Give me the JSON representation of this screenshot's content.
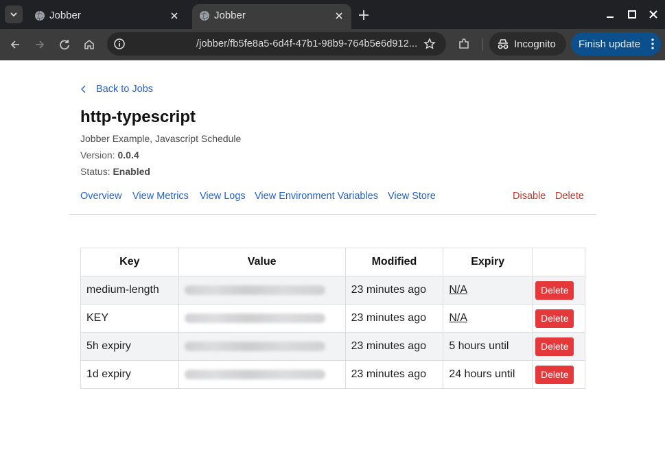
{
  "browser": {
    "tabs": [
      {
        "title": "Jobber",
        "active": false
      },
      {
        "title": "Jobber",
        "active": true
      }
    ],
    "url": "/jobber/fb5fe8a5-6d4f-47b1-98b9-764b5e6d912...",
    "incognito_label": "Incognito",
    "finish_update_label": "Finish update",
    "icons": [
      "tab-search-icon",
      "globe-icon",
      "close-icon",
      "plus-icon",
      "minimize-icon",
      "maximize-icon",
      "window-close-icon",
      "back-arrow-icon",
      "forward-arrow-icon",
      "reload-icon",
      "home-icon",
      "info-icon",
      "star-icon",
      "extensions-icon",
      "incognito-icon",
      "more-vert-icon"
    ]
  },
  "page": {
    "back_label": "Back to Jobs",
    "title": "http-typescript",
    "description": "Jobber Example, Javascript Schedule",
    "version_label": "Version: ",
    "version_value": "0.0.4",
    "status_label": "Status: ",
    "status_value": "Enabled",
    "nav": {
      "overview": "Overview",
      "metrics": "View Metrics",
      "logs": "View Logs",
      "env": "View Environment Variables",
      "store": "View Store",
      "disable": "Disable",
      "delete": "Delete"
    },
    "colors": {
      "link": "#2563c9",
      "danger": "#c0392b",
      "delete_button": "#e5383b"
    }
  },
  "store_table": {
    "headers": {
      "key": "Key",
      "value": "Value",
      "modified": "Modified",
      "expiry": "Expiry",
      "actions": ""
    },
    "rows": [
      {
        "key": "medium-length",
        "value": "",
        "modified": "23 minutes ago",
        "expiry": "N/A",
        "expiry_link": true,
        "action": "Delete"
      },
      {
        "key": "KEY",
        "value": "",
        "modified": "23 minutes ago",
        "expiry": "N/A",
        "expiry_link": true,
        "action": "Delete"
      },
      {
        "key": "5h expiry",
        "value": "",
        "modified": "23 minutes ago",
        "expiry": "5 hours until",
        "expiry_link": false,
        "action": "Delete"
      },
      {
        "key": "1d expiry",
        "value": "",
        "modified": "23 minutes ago",
        "expiry": "24 hours until",
        "expiry_link": false,
        "action": "Delete"
      }
    ]
  }
}
